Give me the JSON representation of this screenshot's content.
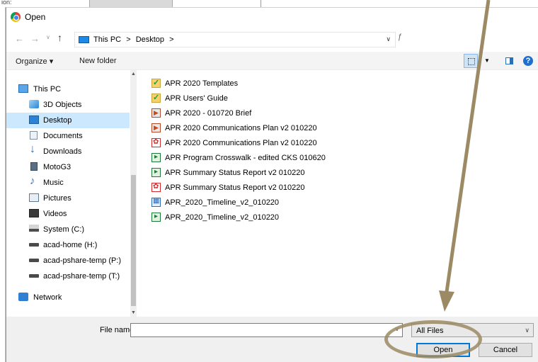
{
  "window": {
    "title": "Open"
  },
  "address": {
    "crumbs": [
      "This PC",
      ">",
      "Desktop",
      ">"
    ],
    "search_stub": "ƒ"
  },
  "toolbar": {
    "organize": "Organize ▾",
    "new_folder": "New folder",
    "help": "?"
  },
  "nav_pane": {
    "items": [
      {
        "label": "This PC",
        "icon": "pc-icon"
      },
      {
        "label": "3D Objects",
        "icon": "3d-objects-icon"
      },
      {
        "label": "Desktop",
        "icon": "desktop-icon",
        "selected": true
      },
      {
        "label": "Documents",
        "icon": "documents-icon"
      },
      {
        "label": "Downloads",
        "icon": "downloads-icon"
      },
      {
        "label": "MotoG3",
        "icon": "phone-icon"
      },
      {
        "label": "Music",
        "icon": "music-icon"
      },
      {
        "label": "Pictures",
        "icon": "pictures-icon"
      },
      {
        "label": "Videos",
        "icon": "videos-icon"
      },
      {
        "label": "System (C:)",
        "icon": "drive-icon"
      },
      {
        "label": "acad-home (H:)",
        "icon": "network-drive-icon"
      },
      {
        "label": "acad-pshare-temp (P:)",
        "icon": "network-drive-icon"
      },
      {
        "label": "acad-pshare-temp (T:)",
        "icon": "network-drive-icon"
      },
      {
        "label": "Network",
        "icon": "network-icon"
      }
    ]
  },
  "files": [
    {
      "name": "APR 2020 Templates",
      "type": "folder"
    },
    {
      "name": "APR Users' Guide",
      "type": "folder"
    },
    {
      "name": "APR 2020 - 010720 Brief",
      "type": "ppt"
    },
    {
      "name": "APR 2020 Communications Plan v2 010220",
      "type": "ppt"
    },
    {
      "name": "APR 2020 Communications Plan v2 010220",
      "type": "pdf"
    },
    {
      "name": "APR Program Crosswalk - edited CKS 010620",
      "type": "xls"
    },
    {
      "name": "APR Summary Status Report v2 010220",
      "type": "xls"
    },
    {
      "name": "APR Summary Status Report v2 010220",
      "type": "pdf"
    },
    {
      "name": "APR_2020_Timeline_v2_010220",
      "type": "mpp"
    },
    {
      "name": "APR_2020_Timeline_v2_010220",
      "type": "xls"
    }
  ],
  "bottom": {
    "file_name_label": "File name:",
    "file_name_value": "",
    "filter": "All Files",
    "open_label": "Open",
    "cancel_label": "Cancel"
  },
  "background": {
    "fragment": "ion:"
  },
  "colors": {
    "selection": "#cce8ff",
    "accent": "#0078d7",
    "annotation": "#9b8a63"
  }
}
